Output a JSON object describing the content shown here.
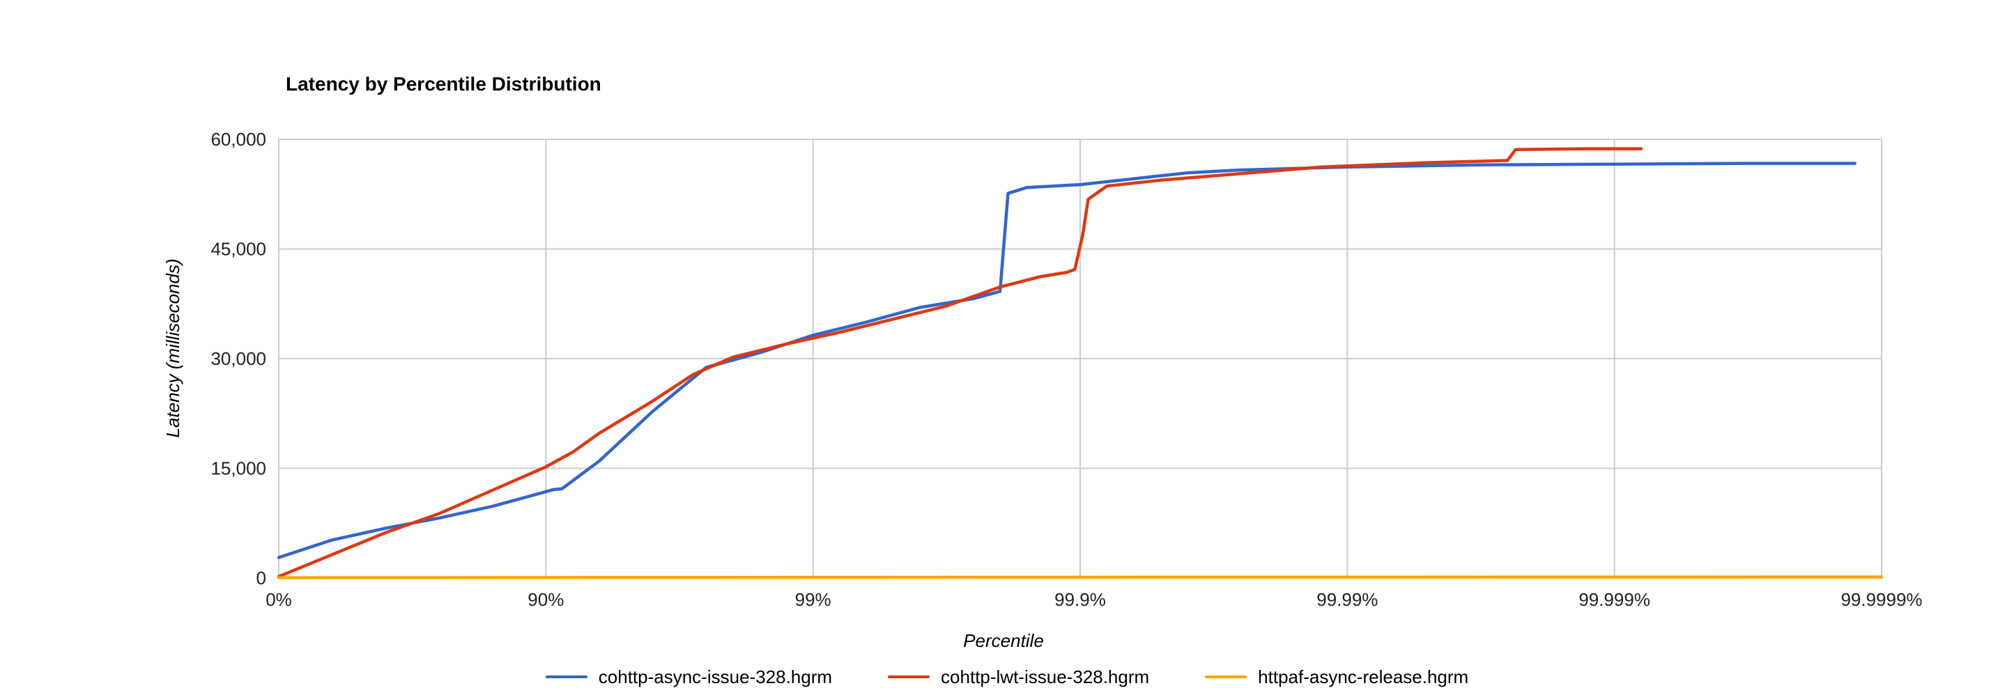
{
  "chart_data": {
    "type": "line",
    "title": "Latency by Percentile Distribution",
    "xlabel": "Percentile",
    "ylabel": "Latency (milliseconds)",
    "ylim": [
      0,
      60000
    ],
    "x_type": "percentile_log",
    "x_ticks": [
      "0%",
      "90%",
      "99%",
      "99.9%",
      "99.99%",
      "99.999%",
      "99.9999%"
    ],
    "y_ticks": [
      0,
      15000,
      30000,
      45000,
      60000
    ],
    "y_tick_labels": [
      "0",
      "15,000",
      "30,000",
      "45,000",
      "60,000"
    ],
    "series": [
      {
        "name": "cohttp-async-issue-328.hgrm",
        "color": "#3366cc",
        "points": [
          [
            0.0,
            2800
          ],
          [
            0.2,
            5200
          ],
          [
            0.4,
            6800
          ],
          [
            0.6,
            8200
          ],
          [
            0.8,
            9800
          ],
          [
            1.0,
            11800
          ],
          [
            1.03,
            12100
          ],
          [
            1.06,
            12200
          ],
          [
            1.2,
            16000
          ],
          [
            1.4,
            22800
          ],
          [
            1.6,
            28800
          ],
          [
            1.8,
            30800
          ],
          [
            2.0,
            33200
          ],
          [
            2.2,
            35000
          ],
          [
            2.4,
            37000
          ],
          [
            2.6,
            38200
          ],
          [
            2.7,
            39200
          ],
          [
            2.73,
            52600
          ],
          [
            2.8,
            53400
          ],
          [
            3.0,
            53800
          ],
          [
            3.2,
            54600
          ],
          [
            3.4,
            55400
          ],
          [
            3.6,
            55800
          ],
          [
            3.8,
            56000
          ],
          [
            4.0,
            56200
          ],
          [
            4.5,
            56500
          ],
          [
            5.0,
            56600
          ],
          [
            5.5,
            56700
          ],
          [
            5.9,
            56700
          ]
        ]
      },
      {
        "name": "cohttp-lwt-issue-328.hgrm",
        "color": "#dc3912",
        "points": [
          [
            0.0,
            200
          ],
          [
            0.2,
            3200
          ],
          [
            0.4,
            6200
          ],
          [
            0.6,
            8800
          ],
          [
            0.8,
            12000
          ],
          [
            1.0,
            15200
          ],
          [
            1.1,
            17200
          ],
          [
            1.2,
            19800
          ],
          [
            1.4,
            24200
          ],
          [
            1.55,
            27800
          ],
          [
            1.7,
            30200
          ],
          [
            1.9,
            32000
          ],
          [
            2.1,
            33600
          ],
          [
            2.3,
            35400
          ],
          [
            2.5,
            37200
          ],
          [
            2.7,
            39800
          ],
          [
            2.85,
            41200
          ],
          [
            2.95,
            41800
          ],
          [
            2.98,
            42200
          ],
          [
            3.01,
            47000
          ],
          [
            3.03,
            51800
          ],
          [
            3.1,
            53600
          ],
          [
            3.3,
            54400
          ],
          [
            3.5,
            55000
          ],
          [
            3.7,
            55600
          ],
          [
            3.9,
            56200
          ],
          [
            4.1,
            56500
          ],
          [
            4.3,
            56800
          ],
          [
            4.5,
            57000
          ],
          [
            4.6,
            57100
          ],
          [
            4.63,
            58600
          ],
          [
            4.9,
            58700
          ],
          [
            5.1,
            58700
          ]
        ]
      },
      {
        "name": "httpaf-async-release.hgrm",
        "color": "#ffa500",
        "points": [
          [
            0.0,
            40
          ],
          [
            1.0,
            60
          ],
          [
            2.0,
            80
          ],
          [
            3.0,
            100
          ],
          [
            4.0,
            110
          ],
          [
            5.0,
            120
          ],
          [
            6.0,
            130
          ]
        ]
      }
    ]
  }
}
